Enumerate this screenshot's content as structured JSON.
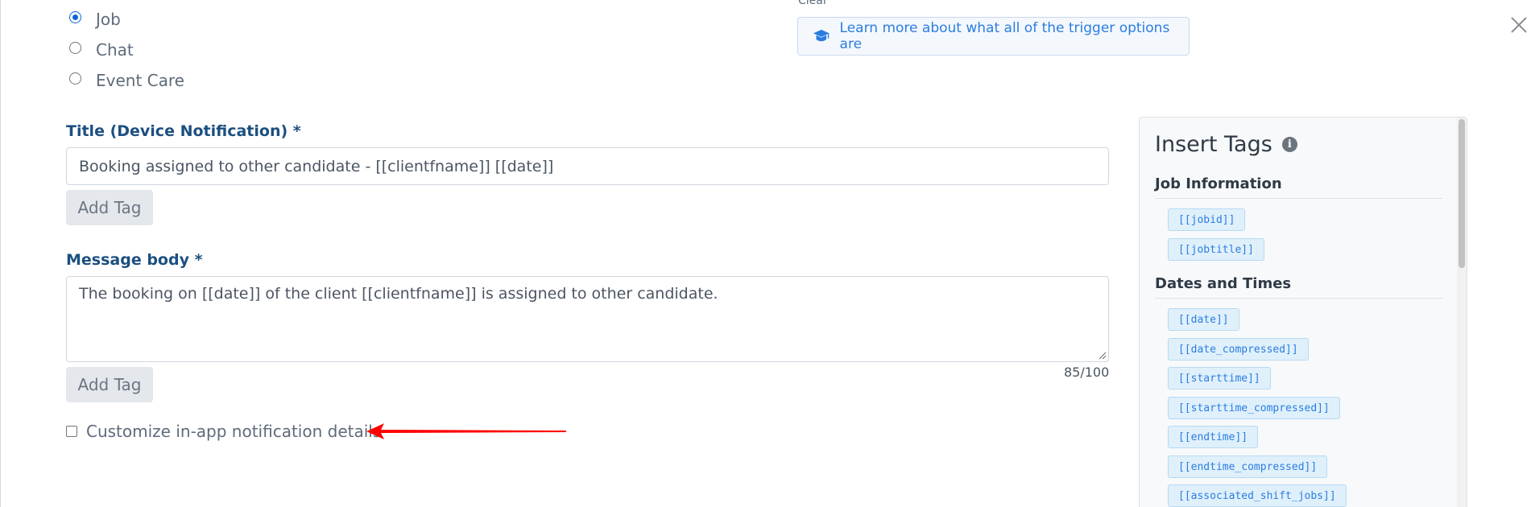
{
  "trigger_type": {
    "options": [
      {
        "label": "Job",
        "checked": true
      },
      {
        "label": "Chat",
        "checked": false
      },
      {
        "label": "Event Care",
        "checked": false
      }
    ],
    "clear_label": "Clear",
    "learn_more": "Learn more about what all of the trigger options are"
  },
  "title_field": {
    "label": "Title (Device Notification) *",
    "value": "Booking assigned to other candidate - [[clientfname]] [[date]]",
    "add_tag_label": "Add Tag"
  },
  "message_field": {
    "label": "Message body *",
    "value": "The booking on [[date]] of the client [[clientfname]] is assigned to other candidate.",
    "counter": "85/100",
    "add_tag_label": "Add Tag"
  },
  "customize_checkbox": {
    "label": "Customize in-app notification details",
    "checked": false
  },
  "annotation": {
    "arrow_color": "#ff0000"
  },
  "tags_panel": {
    "title": "Insert Tags",
    "sections": [
      {
        "title": "Job Information",
        "tags": [
          "[[jobid]]",
          "[[jobtitle]]"
        ]
      },
      {
        "title": "Dates and Times",
        "tags": [
          "[[date]]",
          "[[date_compressed]]",
          "[[starttime]]",
          "[[starttime_compressed]]",
          "[[endtime]]",
          "[[endtime_compressed]]",
          "[[associated_shift_jobs]]"
        ]
      }
    ]
  },
  "colors": {
    "accent": "#2b7de0",
    "label": "#1c4f80",
    "chip_bg": "#dff0fb"
  }
}
